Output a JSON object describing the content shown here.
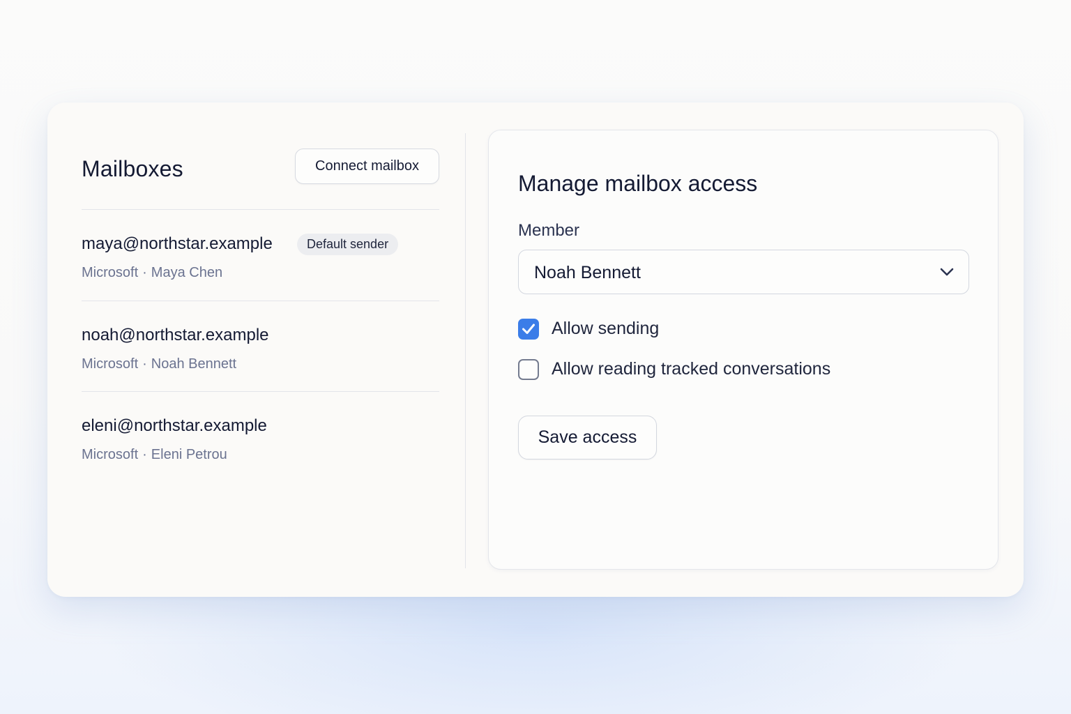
{
  "mailboxes": {
    "title": "Mailboxes",
    "connect_label": "Connect mailbox",
    "items": [
      {
        "email": "maya@northstar.example",
        "provider": "Microsoft",
        "owner": "Maya Chen",
        "badge": "Default sender"
      },
      {
        "email": "noah@northstar.example",
        "provider": "Microsoft",
        "owner": "Noah Bennett"
      },
      {
        "email": "eleni@northstar.example",
        "provider": "Microsoft",
        "owner": "Eleni Petrou"
      }
    ]
  },
  "access": {
    "title": "Manage mailbox access",
    "member_label": "Member",
    "member_value": "Noah Bennett",
    "allow_sending": {
      "label": "Allow sending",
      "checked": true
    },
    "allow_reading": {
      "label": "Allow reading tracked conversations",
      "checked": false
    },
    "save_label": "Save access"
  },
  "colors": {
    "accent": "#3b7de8",
    "text": "#141a33",
    "muted": "#6b7390"
  },
  "icons": {
    "chevron": "chevron-down-icon",
    "check": "check-icon"
  }
}
